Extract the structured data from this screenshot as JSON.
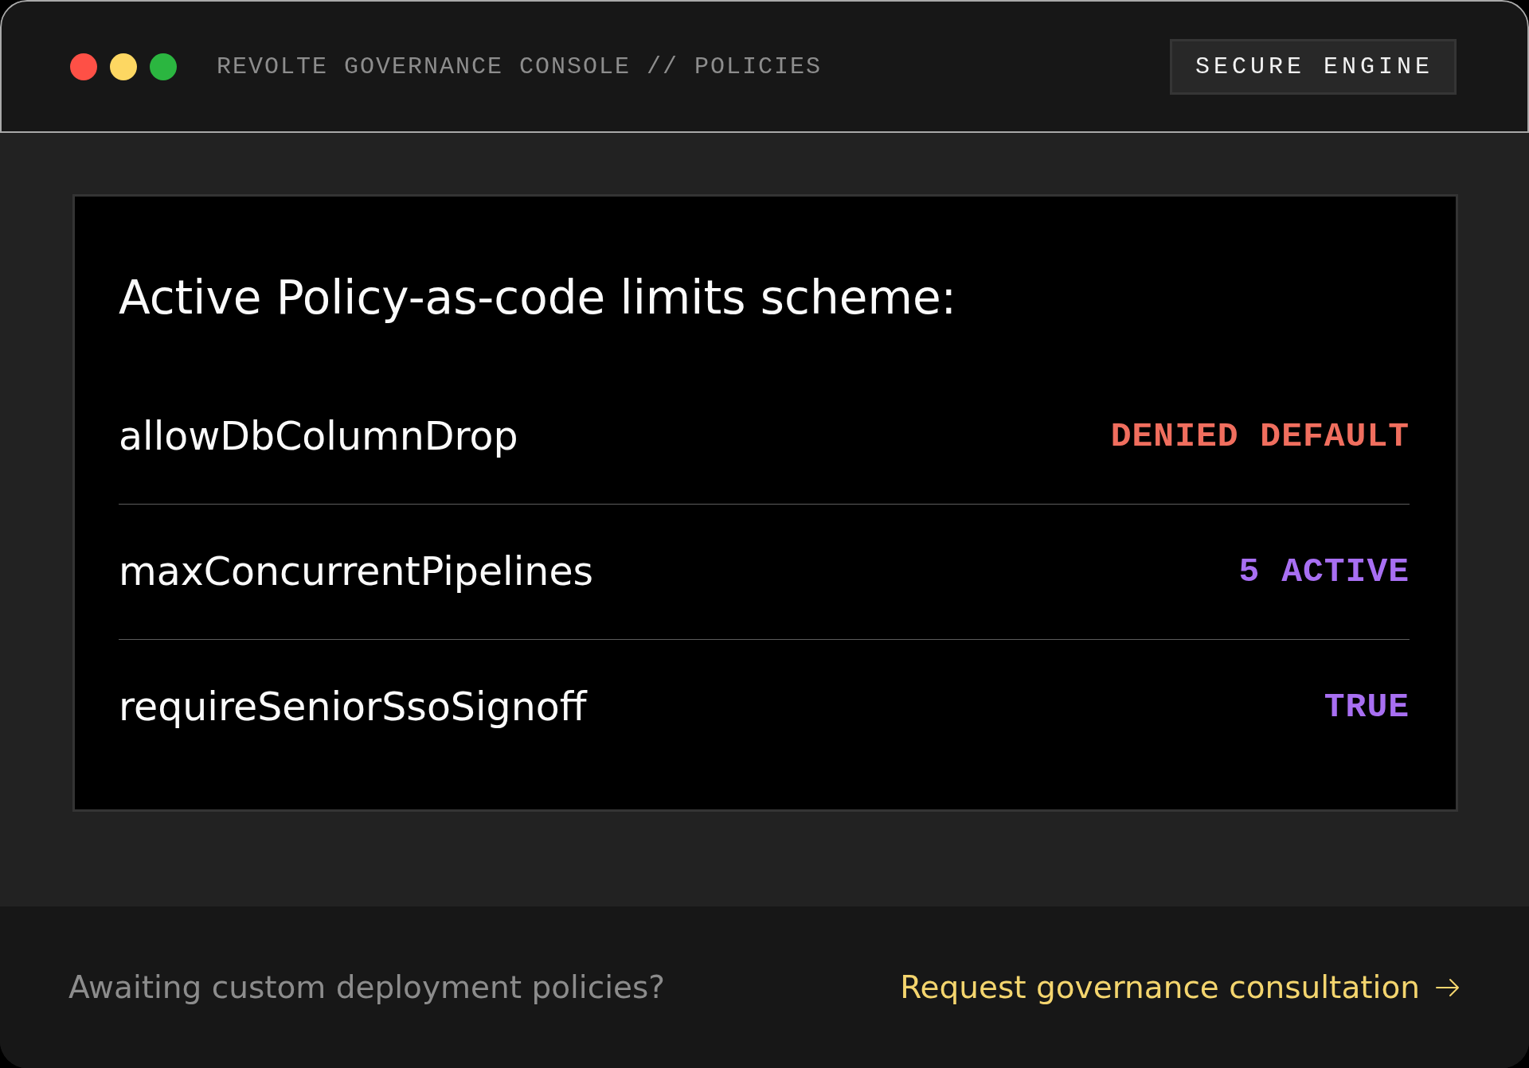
{
  "window": {
    "controls": [
      {
        "color": "#fe5046"
      },
      {
        "color": "#fdd762"
      },
      {
        "color": "#2bb640"
      }
    ],
    "title": "REVOLTE GOVERNANCE CONSOLE // POLICIES",
    "badge": "SECURE ENGINE"
  },
  "policy_card": {
    "title": "Active Policy-as-code limits scheme:",
    "rows": [
      {
        "name": "allowDbColumnDrop",
        "value": "DENIED DEFAULT",
        "color": "#f06e5e"
      },
      {
        "name": "maxConcurrentPipelines",
        "value": "5 ACTIVE",
        "color": "#a86ff2"
      },
      {
        "name": "requireSeniorSsoSignoff",
        "value": "TRUE",
        "color": "#a86ff2"
      }
    ]
  },
  "footer": {
    "prompt": "Awaiting custom deployment policies?",
    "link": "Request governance consultation"
  }
}
